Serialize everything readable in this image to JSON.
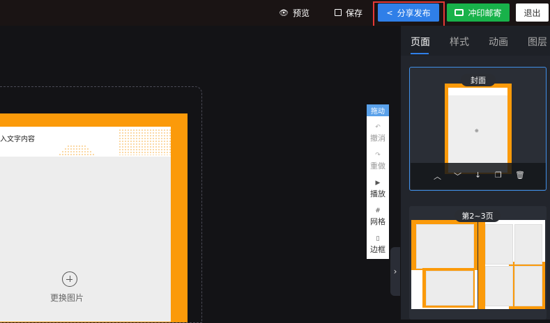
{
  "topbar": {
    "preview_label": "预览",
    "save_label": "保存",
    "share_label": "分享发布",
    "print_label": "冲印邮寄",
    "logout_label": "退出"
  },
  "canvas": {
    "page_text": "入文字内容",
    "replace_label": "更换图片"
  },
  "toolbox": {
    "drag_label": "拖动",
    "undo_label": "撤消",
    "redo_label": "重做",
    "play_label": "播放",
    "grid_label": "网格",
    "border_label": "边框"
  },
  "panel": {
    "tabs": [
      "页面",
      "样式",
      "动画",
      "图层"
    ],
    "cards": [
      {
        "label": "封面"
      },
      {
        "label": "第2~3页"
      }
    ]
  },
  "colors": {
    "accent": "#2f7fe8",
    "print_green": "#18b24a",
    "page_orange": "#fb9a0a",
    "highlight_red": "#e53935"
  }
}
